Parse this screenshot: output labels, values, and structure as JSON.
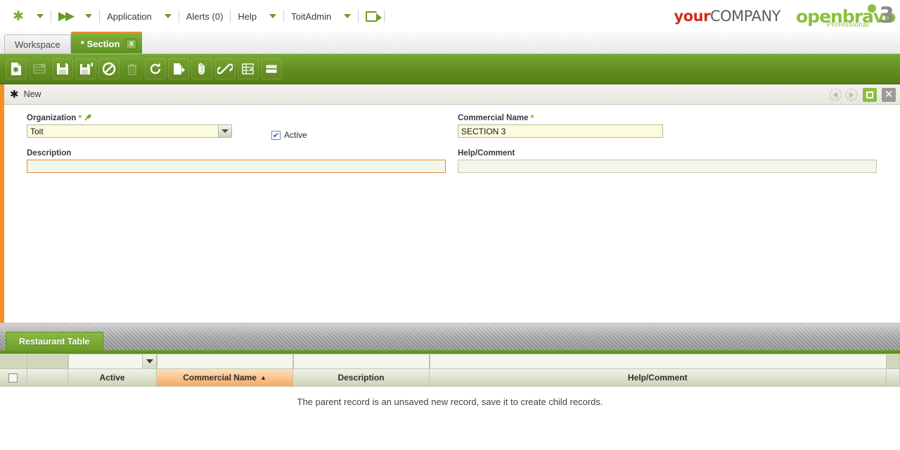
{
  "topnav": {
    "items": [
      {
        "id": "app-logo",
        "icon": "asterisk-icon",
        "label": ""
      },
      {
        "id": "fastforward",
        "icon": "fast-forward-icon",
        "label": ""
      },
      {
        "id": "application",
        "label": "Application"
      },
      {
        "id": "alerts",
        "label": "Alerts (0)"
      },
      {
        "id": "help",
        "label": "Help"
      },
      {
        "id": "user",
        "label": "ToitAdmin"
      },
      {
        "id": "logout",
        "icon": "logout-icon",
        "label": ""
      }
    ]
  },
  "logos": {
    "company_a": "your",
    "company_b": "COMPANY",
    "openbravo_word": "openbravo",
    "openbravo_three": "3",
    "openbravo_edition": "Professional"
  },
  "tabs": [
    {
      "label": "Workspace",
      "active": false,
      "closable": false
    },
    {
      "label": "* Section",
      "active": true,
      "closable": true,
      "close_label": "x"
    }
  ],
  "toolbar": {
    "buttons": [
      {
        "name": "new-record-in-form-button",
        "icon": "new-document-icon",
        "disabled": false
      },
      {
        "name": "new-record-in-grid-button",
        "icon": "new-grid-row-icon",
        "disabled": true
      },
      {
        "name": "save-button",
        "icon": "save-icon",
        "disabled": false
      },
      {
        "name": "save-and-new-button",
        "icon": "save-new-icon",
        "disabled": false
      },
      {
        "name": "cancel-button",
        "icon": "cancel-icon",
        "disabled": false
      },
      {
        "name": "delete-button",
        "icon": "trash-icon",
        "disabled": true
      },
      {
        "name": "refresh-button",
        "icon": "refresh-icon",
        "disabled": false
      },
      {
        "name": "export-button",
        "icon": "export-icon",
        "disabled": false
      },
      {
        "name": "attachment-button",
        "icon": "paperclip-icon",
        "disabled": false
      },
      {
        "name": "link-button",
        "icon": "chain-link-icon",
        "disabled": false
      },
      {
        "name": "audit-button",
        "icon": "wrench-grid-icon",
        "disabled": false
      },
      {
        "name": "view-mode-button",
        "icon": "grid-form-view-icon",
        "disabled": false
      }
    ]
  },
  "form": {
    "header_title": "New",
    "header_icon": "asterisk-icon",
    "controls": {
      "previous": "previous-record",
      "next": "next-record",
      "maximize": "maximize-form",
      "close": "close-form",
      "close_glyph": "✕"
    },
    "fields": {
      "organization": {
        "label": "Organization",
        "required_mark": "*",
        "link_icon": "link-reference-icon",
        "value": "Toit",
        "placeholder": ""
      },
      "active": {
        "label": "Active",
        "checked": true,
        "check_glyph": "✔"
      },
      "commercial_name": {
        "label": "Commercial Name",
        "required_mark": "*",
        "value": "SECTION 3",
        "placeholder": ""
      },
      "description": {
        "label": "Description",
        "value": "",
        "placeholder": "",
        "focused": true
      },
      "help_comment": {
        "label": "Help/Comment",
        "value": "",
        "placeholder": ""
      }
    }
  },
  "child": {
    "tabs": [
      {
        "label": "Restaurant Table",
        "active": true
      }
    ],
    "grid": {
      "columns": [
        {
          "key": "select",
          "label": "",
          "sorted": false
        },
        {
          "key": "icons",
          "label": "",
          "sorted": false
        },
        {
          "key": "active",
          "label": "Active",
          "sorted": false
        },
        {
          "key": "commercial_name",
          "label": "Commercial Name",
          "sorted": true,
          "sort_dir": "▲"
        },
        {
          "key": "description",
          "label": "Description",
          "sorted": false
        },
        {
          "key": "help_comment",
          "label": "Help/Comment",
          "sorted": false
        }
      ],
      "filters": {
        "active": "",
        "commercial_name": "",
        "description": "",
        "help_comment": ""
      },
      "rows": [],
      "empty_message": "The parent record is an unsaved new record, save it to create child records."
    }
  },
  "colors": {
    "brand_green": "#6d9e28",
    "toolbar_green": "#63901f",
    "accent_orange": "#f59123",
    "sort_orange": "#f5a961",
    "required_field_bg": "#fbfbdd",
    "editable_field_bg": "#f3f6ec",
    "grid_header_green": "#ccd4b6"
  }
}
